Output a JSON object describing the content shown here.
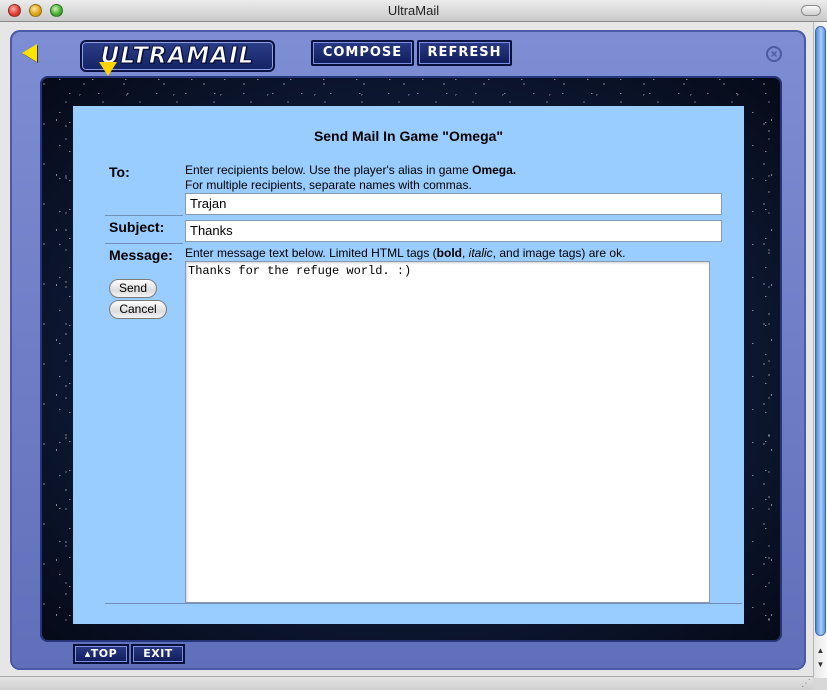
{
  "window": {
    "title": "UltraMail"
  },
  "header": {
    "logo_text": "ULTRAMAIL",
    "compose_label": "COMPOSE",
    "refresh_label": "REFRESH"
  },
  "form": {
    "title": "Send Mail In Game \"Omega\"",
    "to_label": "To:",
    "to_hint_line1_prefix": "Enter recipients below. Use the player's alias in game ",
    "to_hint_line1_bold": "Omega.",
    "to_hint_line2": "For multiple recipients, separate names with commas.",
    "to_value": "Trajan",
    "subject_label": "Subject:",
    "subject_value": "Thanks",
    "message_label": "Message:",
    "message_hint_prefix": "Enter message text below. Limited HTML tags (",
    "message_hint_bold": "bold",
    "message_hint_sep": ", ",
    "message_hint_italic": "italic",
    "message_hint_suffix": ", and image tags) are ok.",
    "message_value": "Thanks for the refuge world. :)",
    "send_label": "Send",
    "cancel_label": "Cancel"
  },
  "footer": {
    "top_label": "▴TOP",
    "exit_label": "EXIT"
  },
  "colors": {
    "panel": "#99ccff",
    "frame": "#6f7fc6",
    "button_navy": "#142365",
    "accent_yellow": "#ffe400"
  }
}
